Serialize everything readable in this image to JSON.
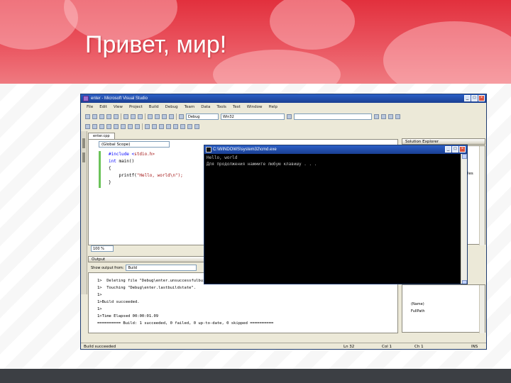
{
  "slide": {
    "title": "Привет, мир!",
    "colors": {
      "header": "#e2303d",
      "footer": "#3c3f44"
    }
  },
  "vs": {
    "title": "enter - Microsoft Visual Studio",
    "menu": [
      "File",
      "Edit",
      "View",
      "Project",
      "Build",
      "Debug",
      "Team",
      "Data",
      "Tools",
      "Test",
      "Window",
      "Help"
    ],
    "config_combo": "Debug",
    "platform_combo": "Win32",
    "doc_tab": "enter.cpp",
    "scope_combo": "(Global Scope)",
    "code_lines": [
      {
        "pre": "#include <",
        "kw": "",
        "post": "stdio.h>"
      },
      {
        "pre": "",
        "kw": "int",
        "post": " main()"
      },
      {
        "pre": "{",
        "kw": "",
        "post": ""
      },
      {
        "pre": "    printf(",
        "kw": "",
        "post": "\"Hello, world\\n\");"
      },
      {
        "pre": "}",
        "kw": "",
        "post": ""
      }
    ],
    "zoom": "100 %",
    "output_title": "Output",
    "output_show_label": "Show output from:",
    "output_show_value": "Build",
    "output_lines": [
      "1>  Deleting file \"Debug\\enter.unsuccessfulbuild\".",
      "1>  Touching \"Debug\\enter.lastbuildstate\".",
      "1>",
      "1>Build succeeded.",
      "1>",
      "1>Time Elapsed 00:00:01.09",
      "========== Build: 1 succeeded, 0 failed, 0 up-to-date, 0 skipped =========="
    ],
    "solution_title": "Solution Explorer",
    "solution_text": "les",
    "properties_rows": [
      "(Name)",
      "FullPath"
    ],
    "status_left": "Build succeeded",
    "status_ln": "Ln 32",
    "status_col": "Col 1",
    "status_ch": "Ch 1",
    "status_ins": "INS"
  },
  "console": {
    "title": "C:\\WINDOWS\\system32\\cmd.exe",
    "lines": [
      "Hello, world",
      "Для продолжения нажмите любую клавишу . . ."
    ]
  }
}
